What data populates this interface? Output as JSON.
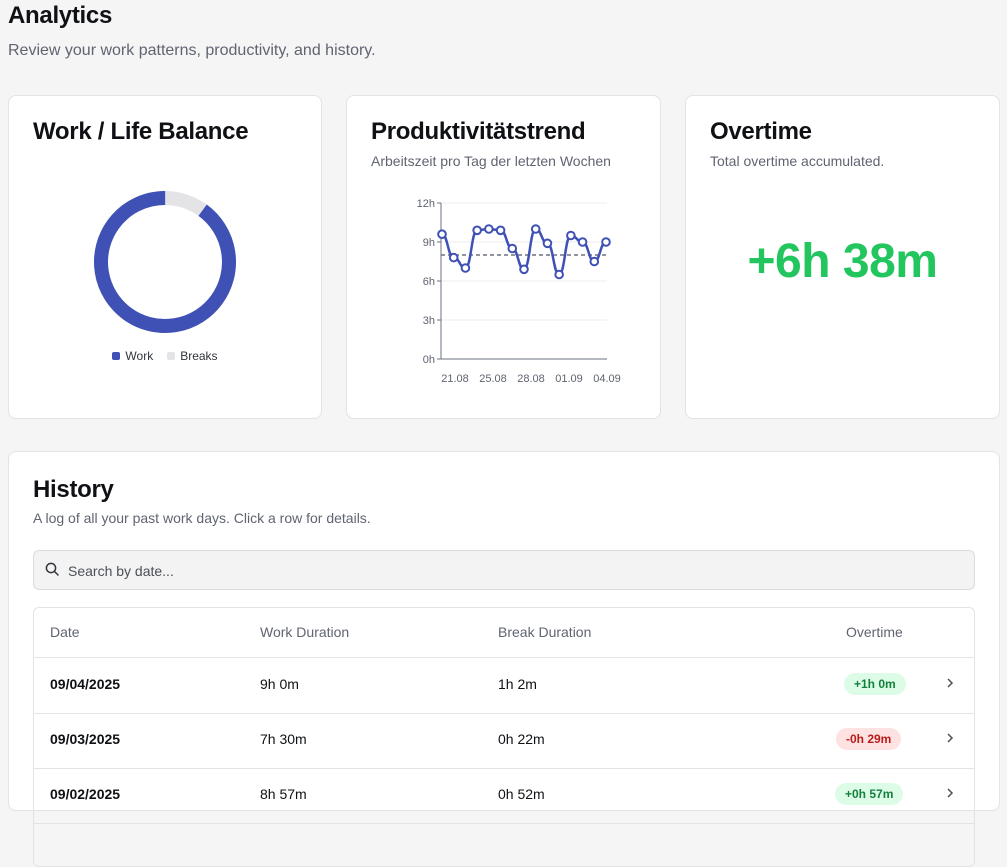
{
  "page": {
    "title": "Analytics",
    "subtitle": "Review your work patterns, productivity, and history."
  },
  "balance": {
    "title": "Work / Life Balance",
    "legend": [
      {
        "label": "Work",
        "color": "#3f51b5"
      },
      {
        "label": "Breaks",
        "color": "#e4e4e7"
      }
    ],
    "work_fraction": 0.9
  },
  "trend": {
    "title": "Produktivitätstrend",
    "description": "Arbeitszeit pro Tag der letzten Wochen"
  },
  "chart_data": {
    "type": "line",
    "x_tick_labels": [
      "21.08",
      "25.08",
      "28.08",
      "01.09",
      "04.09"
    ],
    "y_tick_labels": [
      "12h",
      "9h",
      "6h",
      "3h",
      "0h"
    ],
    "ylim": [
      0,
      12
    ],
    "series": [
      {
        "values": [
          9.6,
          7.8,
          7.0,
          9.9,
          10.0,
          9.9,
          8.5,
          6.9,
          10.0,
          8.9,
          6.5,
          9.5,
          9.0,
          7.5,
          9.0
        ]
      }
    ],
    "reference_line": 8.0,
    "line_color": "#3f51b5",
    "grid": true
  },
  "overtime": {
    "title": "Overtime",
    "description": "Total overtime accumulated.",
    "value": "+6h 38m",
    "color": "#22c55e"
  },
  "history": {
    "title": "History",
    "description": "A log of all your past work days. Click a row for details.",
    "search_placeholder": "Search by date...",
    "columns": [
      "Date",
      "Work Duration",
      "Break Duration",
      "Overtime"
    ],
    "rows": [
      {
        "date": "09/04/2025",
        "work": "9h 0m",
        "break": "1h 2m",
        "overtime": "+1h 0m",
        "status": "positive"
      },
      {
        "date": "09/03/2025",
        "work": "7h 30m",
        "break": "0h 22m",
        "overtime": "-0h 29m",
        "status": "negative"
      },
      {
        "date": "09/02/2025",
        "work": "8h 57m",
        "break": "0h 52m",
        "overtime": "+0h 57m",
        "status": "positive"
      }
    ]
  }
}
